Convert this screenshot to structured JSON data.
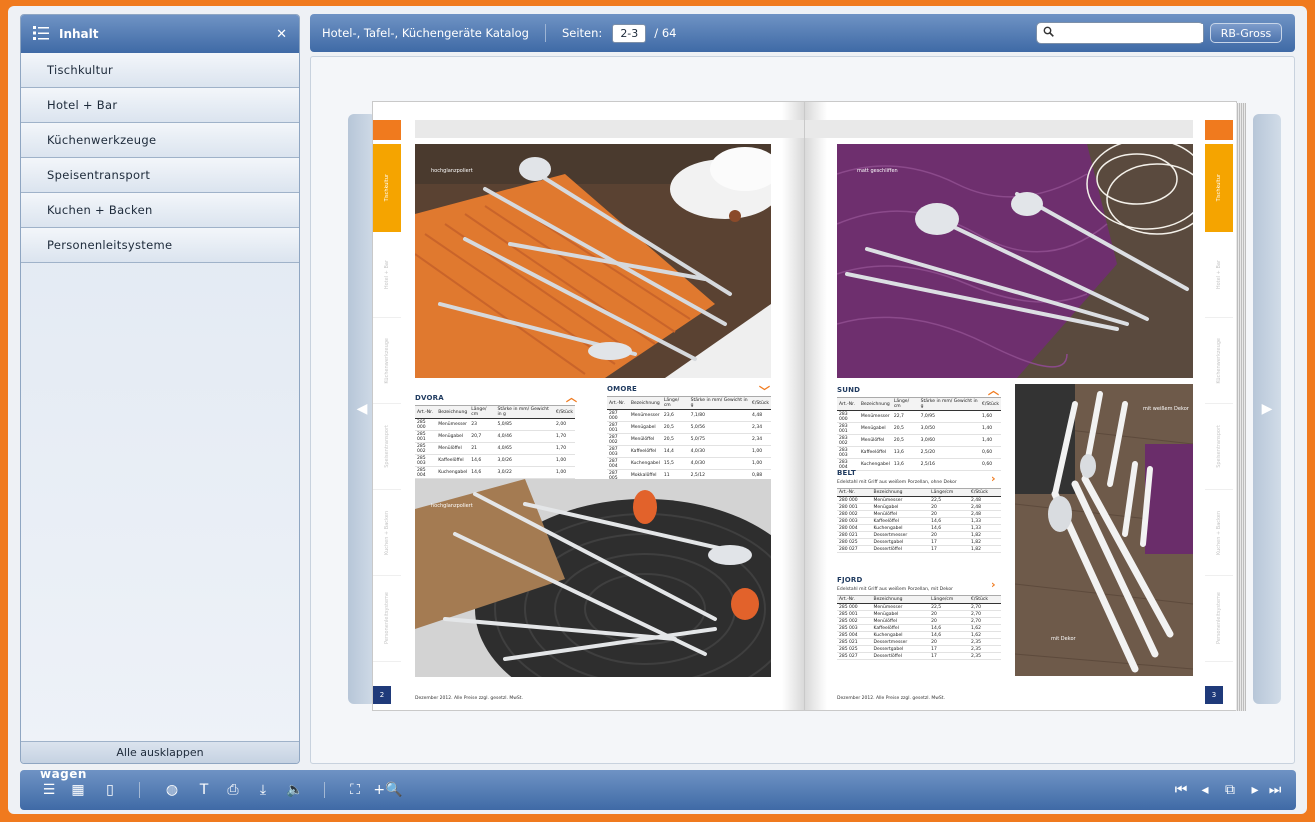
{
  "sidebar": {
    "title": "Inhalt",
    "items": [
      {
        "label": "Tischkultur"
      },
      {
        "label": "Hotel + Bar"
      },
      {
        "label": "Küchenwerkzeuge"
      },
      {
        "label": "Speisentransport"
      },
      {
        "label": "Kuchen + Backen"
      },
      {
        "label": "Personenleitsysteme"
      }
    ],
    "expand_all": "Alle ausklappen"
  },
  "topbar": {
    "catalog_title": "Hotel-, Tafel-, Küchengeräte Katalog",
    "pages_label": "Seiten:",
    "current_pages": "2-3",
    "total_pages": "/ 64",
    "search_value": "",
    "rb_button": "RB-Gross"
  },
  "book": {
    "left": {
      "page_number": "2",
      "footer": "Dezember 2012. Alle Preise zzgl. gesetzl. MwSt.",
      "photo1_label": "hochglanzpoliert",
      "photo2_label": "hochglanzpoliert",
      "side_tabs": [
        "Tischkultur",
        "Hotel + Bar",
        "Küchenwerkzeuge",
        "Speisentransport",
        "Kuchen + Backen",
        "Personenleitsysteme"
      ],
      "products": [
        {
          "name": "DVORA",
          "headers": [
            "Art.-Nr.",
            "Bezeichnung",
            "Länge/ cm",
            "Stärke in mm/ Gewicht in g",
            "€/Stück"
          ],
          "rows": [
            [
              "285 000",
              "Menümesser",
              "23",
              "5,0/85",
              "2,00"
            ],
            [
              "285 001",
              "Menügabel",
              "20,7",
              "4,0/46",
              "1,70"
            ],
            [
              "285 002",
              "Menülöffel",
              "21",
              "4,0/65",
              "1,70"
            ],
            [
              "285 003",
              "Kaffeelöffel",
              "14,6",
              "3,0/26",
              "1,00"
            ],
            [
              "285 004",
              "Kuchengabel",
              "14,6",
              "3,0/22",
              "1,00"
            ]
          ]
        },
        {
          "name": "OMORE",
          "headers": [
            "Art.-Nr.",
            "Bezeichnung",
            "Länge/ cm",
            "Stärke in mm/ Gewicht in g",
            "€/Stück"
          ],
          "rows": [
            [
              "287 000",
              "Menümesser",
              "23,6",
              "7,1/80",
              "4,48"
            ],
            [
              "287 001",
              "Menügabel",
              "20,5",
              "5,0/56",
              "2,34"
            ],
            [
              "287 002",
              "Menülöffel",
              "20,5",
              "5,0/75",
              "2,34"
            ],
            [
              "287 003",
              "Kaffeelöffel",
              "14,4",
              "4,0/30",
              "1,00"
            ],
            [
              "287 004",
              "Kuchengabel",
              "15,5",
              "4,0/30",
              "1,00"
            ],
            [
              "287 005",
              "Mokkalöffel",
              "11",
              "2,5/12",
              "0,88"
            ]
          ]
        }
      ]
    },
    "right": {
      "page_number": "3",
      "footer": "Dezember 2012. Alle Preise zzgl. gesetzl. MwSt.",
      "photo1_label": "matt geschliffen",
      "photo2_label_top": "mit weißem Dekor",
      "photo2_label_bottom": "mit Dekor",
      "side_tabs": [
        "Tischkultur",
        "Hotel + Bar",
        "Küchenwerkzeuge",
        "Speisentransport",
        "Kuchen + Backen",
        "Personenleitsysteme"
      ],
      "products": [
        {
          "name": "SUND",
          "desc": "",
          "headers": [
            "Art.-Nr.",
            "Bezeichnung",
            "Länge/ cm",
            "Stärke in mm/ Gewicht in g",
            "€/Stück"
          ],
          "rows": [
            [
              "283 000",
              "Menümesser",
              "22,7",
              "7,0/95",
              "1,60"
            ],
            [
              "283 001",
              "Menügabel",
              "20,5",
              "3,0/50",
              "1,40"
            ],
            [
              "283 002",
              "Menülöffel",
              "20,5",
              "3,0/60",
              "1,40"
            ],
            [
              "283 003",
              "Kaffeelöffel",
              "13,6",
              "2,5/20",
              "0,60"
            ],
            [
              "283 004",
              "Kuchengabel",
              "13,6",
              "2,5/16",
              "0,60"
            ]
          ]
        },
        {
          "name": "BELT",
          "desc": "Edelstahl mit Griff aus weißem Porzellan, ohne Dekor",
          "headers": [
            "Art.-Nr.",
            "Bezeichnung",
            "Länge/cm",
            "€/Stück"
          ],
          "rows": [
            [
              "280 000",
              "Menümesser",
              "22,5",
              "2,48"
            ],
            [
              "280 001",
              "Menügabel",
              "20",
              "2,48"
            ],
            [
              "280 002",
              "Menülöffel",
              "20",
              "2,48"
            ],
            [
              "280 003",
              "Kaffeelöffel",
              "14,6",
              "1,33"
            ],
            [
              "280 004",
              "Kuchengabel",
              "14,6",
              "1,33"
            ],
            [
              "280 021",
              "Dessertmesser",
              "20",
              "1,82"
            ],
            [
              "280 025",
              "Dessertgabel",
              "17",
              "1,82"
            ],
            [
              "280 027",
              "Dessertlöffel",
              "17",
              "1,82"
            ]
          ]
        },
        {
          "name": "FJORD",
          "desc": "Edelstahl mit Griff aus weißem Porzellan, mit Dekor",
          "headers": [
            "Art.-Nr.",
            "Bezeichnung",
            "Länge/cm",
            "€/Stück"
          ],
          "rows": [
            [
              "285 000",
              "Menümesser",
              "22,5",
              "2,70"
            ],
            [
              "285 001",
              "Menügabel",
              "20",
              "2,70"
            ],
            [
              "285 002",
              "Menülöffel",
              "20",
              "2,70"
            ],
            [
              "285 003",
              "Kaffeelöffel",
              "14,6",
              "1,62"
            ],
            [
              "285 004",
              "Kuchengabel",
              "14,6",
              "1,62"
            ],
            [
              "285 021",
              "Dessertmesser",
              "20",
              "2,35"
            ],
            [
              "285 025",
              "Dessertgabel",
              "17",
              "2,35"
            ],
            [
              "285 027",
              "Dessertlöffel",
              "17",
              "2,35"
            ]
          ]
        }
      ]
    }
  },
  "bottombar": {
    "brand": "wagen"
  }
}
